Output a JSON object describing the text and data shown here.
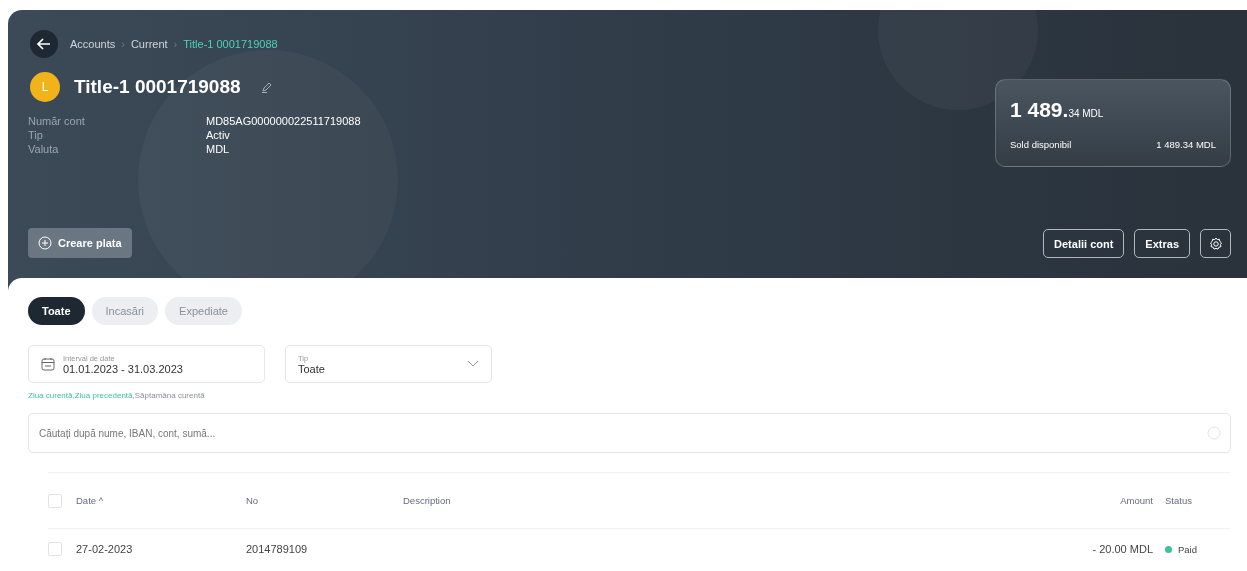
{
  "breadcrumb_separator": "›",
  "breadcrumb": [
    {
      "label": "Accounts",
      "selected": false
    },
    {
      "label": "Current",
      "selected": false
    },
    {
      "label": "Title-1 0001719088",
      "selected": true
    }
  ],
  "account": {
    "avatar": "L",
    "title": "Title-1 0001719088",
    "details": [
      {
        "label": "Număr cont",
        "value": "MD85AG000000022511719088"
      },
      {
        "label": "Tip",
        "value": "Activ"
      },
      {
        "label": "Valuta",
        "value": "MDL"
      }
    ]
  },
  "balance": {
    "whole": "1 489.",
    "fraction": "34 MDL",
    "label": "Sold disponibil",
    "value": "1 489.34 MDL"
  },
  "create_button": "Creare plata",
  "actions": [
    "Detalii cont",
    "Extras"
  ],
  "tabs": [
    {
      "label": "Toate",
      "selected": true
    },
    {
      "label": "Incasări",
      "selected": false
    },
    {
      "label": "Expediate",
      "selected": false
    }
  ],
  "date_filter": {
    "label": "Interval de date",
    "value": "01.01.2023 - 31.03.2023"
  },
  "type_filter": {
    "label": "Tip",
    "value": "Toate"
  },
  "quick_links": [
    {
      "label": "Ziua curentă,",
      "active": true
    },
    {
      "label": "Ziua precedentă,",
      "active": true
    },
    {
      "label": "Săptamâna curentă",
      "active": false
    }
  ],
  "search": {
    "placeholder": "Căutați după nume, IBAN, cont, sumă..."
  },
  "table": {
    "select_all_checked": false,
    "columns": [
      "Date ^",
      "No",
      "Description",
      "Amount",
      "Status"
    ],
    "rows": [
      {
        "date": "27-02-2023",
        "no": "2014789109",
        "amount": "- 20.00 MDL",
        "status": "Paid",
        "color": "#3fbfa0",
        "checked": false
      }
    ]
  }
}
